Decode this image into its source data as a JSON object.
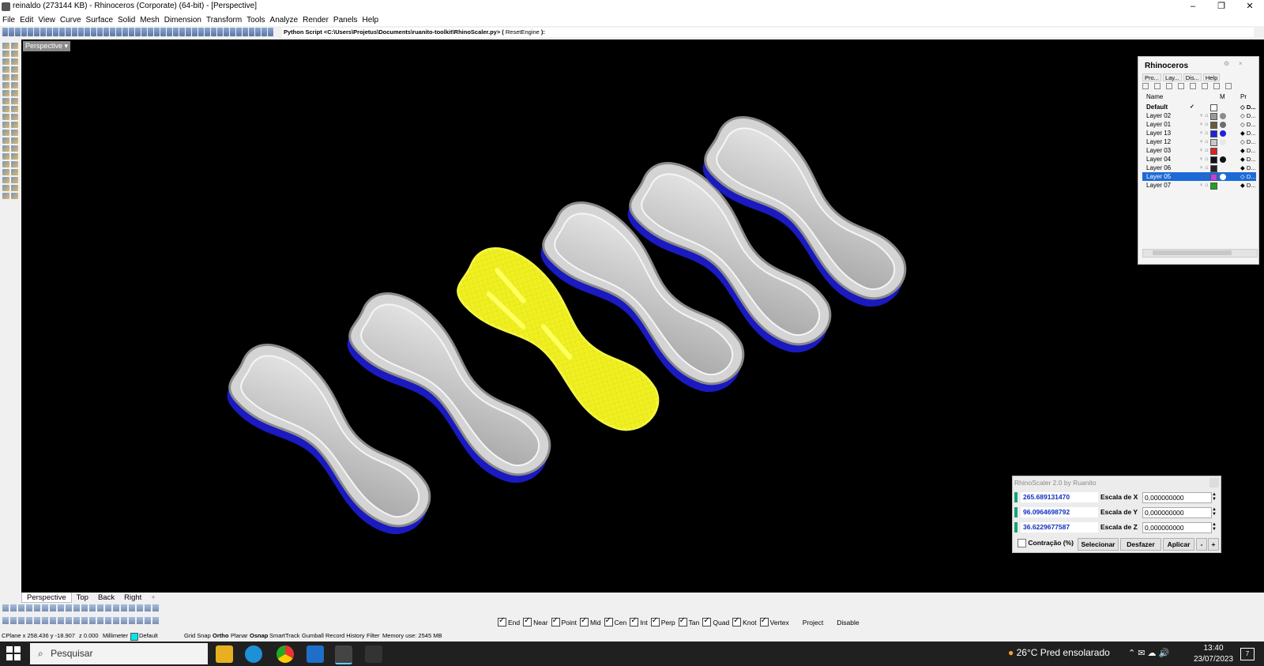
{
  "window": {
    "title": "reinaldo (273144 KB) - Rhinoceros (Corporate) (64-bit) - [Perspective]",
    "controls": [
      "–",
      "❐",
      "✕"
    ]
  },
  "menu": [
    "File",
    "Edit",
    "View",
    "Curve",
    "Surface",
    "Solid",
    "Mesh",
    "Dimension",
    "Transform",
    "Tools",
    "Analyze",
    "Render",
    "Panels",
    "Help"
  ],
  "command_line": {
    "text": "Python Script <C:\\Users\\Projetus\\Documents\\ruanito-toolkit\\RhinoScaler.py> ( ",
    "option": "ResetEngine",
    "suffix": " ):"
  },
  "viewport": {
    "label": "Perspective",
    "dropdown_icon": "triangle-down-icon"
  },
  "layers_panel": {
    "title": "Rhinoceros",
    "tabs": [
      "Pro...",
      "Lay...",
      "Dis...",
      "Help"
    ],
    "col_name": "Name",
    "col_material": "M",
    "col_print": "Pr",
    "layers": [
      {
        "name": "Default",
        "color": "#ffffff",
        "material": "",
        "print": "◇ D...",
        "check": "✓",
        "selected": false,
        "current": true
      },
      {
        "name": "Layer 02",
        "color": "#9a9a9a",
        "material": "#8c8c8c",
        "print": "◇ D...",
        "check": "",
        "selected": false,
        "current": false
      },
      {
        "name": "Layer 01",
        "color": "#6b5a3a",
        "material": "#6e6e6e",
        "print": "◇ D...",
        "check": "",
        "selected": false,
        "current": false
      },
      {
        "name": "Layer 13",
        "color": "#2020e0",
        "material": "#2020e0",
        "print": "◆ D...",
        "check": "",
        "selected": false,
        "current": false
      },
      {
        "name": "Layer 12",
        "color": "#c8c8c8",
        "material": "#e8e8e8",
        "print": "◇ D...",
        "check": "",
        "selected": false,
        "current": false
      },
      {
        "name": "Layer 03",
        "color": "#e02020",
        "material": "",
        "print": "◆ D...",
        "check": "",
        "selected": false,
        "current": false
      },
      {
        "name": "Layer 04",
        "color": "#111111",
        "material": "#111111",
        "print": "◆ D...",
        "check": "",
        "selected": false,
        "current": false
      },
      {
        "name": "Layer 06",
        "color": "#222222",
        "material": "",
        "print": "◆ D...",
        "check": "",
        "selected": false,
        "current": false
      },
      {
        "name": "Layer 05",
        "color": "#c040e0",
        "material": "#ffffff",
        "print": "◇ D...",
        "check": "",
        "selected": true,
        "current": false
      },
      {
        "name": "Layer 07",
        "color": "#20a020",
        "material": "",
        "print": "◆ D...",
        "check": "",
        "selected": false,
        "current": false
      }
    ]
  },
  "scaler": {
    "title": "RhinoScaler 2.0 by Ruanito",
    "rows": [
      {
        "value": "265.689131470",
        "label": "Escala de X",
        "input": "0,000000000"
      },
      {
        "value": "96.0964698792",
        "label": "Escala de Y",
        "input": "0,000000000"
      },
      {
        "value": "36.6229677587",
        "label": "Escala de Z",
        "input": "0,000000000"
      }
    ],
    "contraction_label": "Contração (%)",
    "select_label": "Selecionar",
    "undo_label": "Desfazer",
    "apply_label": "Aplicar",
    "minus_label": "-",
    "plus_label": "+"
  },
  "viewport_tabs": [
    "Perspective",
    "Top",
    "Back",
    "Right",
    "+"
  ],
  "osnap": [
    {
      "label": "End",
      "checked": true
    },
    {
      "label": "Near",
      "checked": true
    },
    {
      "label": "Point",
      "checked": true
    },
    {
      "label": "Mid",
      "checked": true
    },
    {
      "label": "Cen",
      "checked": true
    },
    {
      "label": "Int",
      "checked": true
    },
    {
      "label": "Perp",
      "checked": true
    },
    {
      "label": "Tan",
      "checked": true
    },
    {
      "label": "Quad",
      "checked": true
    },
    {
      "label": "Knot",
      "checked": true
    },
    {
      "label": "Vertex",
      "checked": true
    },
    {
      "label": "Project",
      "checked": false
    },
    {
      "label": "Disable",
      "checked": false
    }
  ],
  "status": {
    "coords": "CPlane  x 258.436  y -18.907",
    "z": "z 0.000",
    "units": "Millimeter",
    "layer": "Default",
    "toggles": [
      "Grid Snap",
      "Ortho",
      "Planar",
      "Osnap",
      "SmartTrack",
      "Gumball",
      "Record History",
      "Filter"
    ],
    "memory": "Memory use: 2545 MB"
  },
  "taskbar": {
    "search_placeholder": "Pesquisar",
    "weather": "26°C  Pred ensolarado",
    "time": "13:40",
    "date": "23/07/2023",
    "notification_count": "7"
  },
  "colors": {
    "viewport_bg": "#000000",
    "selection_yellow": "#f0f020",
    "sole_gray": "#c8c8c8",
    "sole_edge_blue": "#1a1ac0",
    "layer_selected": "#1c6ad6",
    "scaler_value": "#1030c0"
  }
}
